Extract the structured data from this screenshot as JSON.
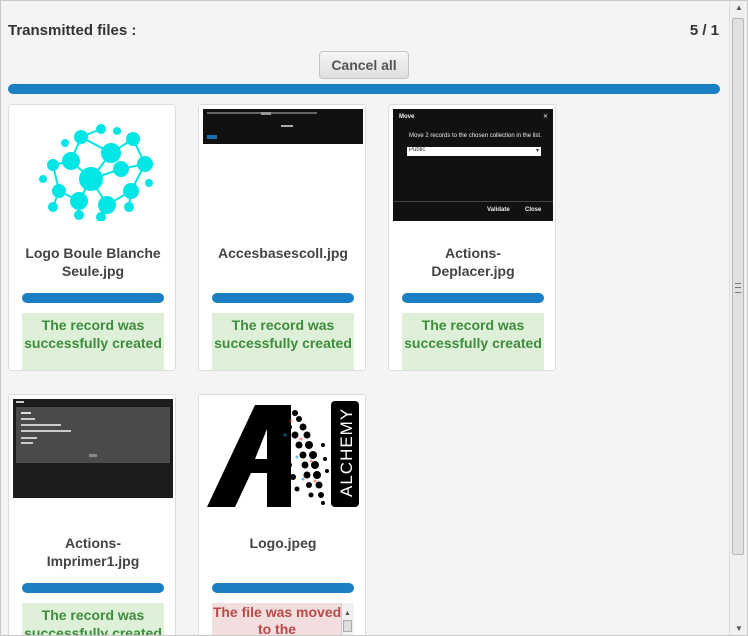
{
  "header": {
    "title": "Transmitted files :",
    "counter": "5 / 1"
  },
  "toolbar": {
    "cancel_all_label": "Cancel all"
  },
  "files": [
    {
      "name": "Logo Boule Blanche Seule.jpg",
      "status": "The record was successfully created",
      "status_type": "success",
      "progress": 1.0
    },
    {
      "name": "Accesbasescoll.jpg",
      "status": "The record was successfully created",
      "status_type": "success",
      "progress": 1.0
    },
    {
      "name": "Actions-Deplacer.jpg",
      "status": "The record was successfully created",
      "status_type": "success",
      "progress": 1.0
    },
    {
      "name": "Actions-Imprimer1.jpg",
      "status": "The record was successfully created",
      "status_type": "success",
      "progress": 1.0
    },
    {
      "name": "Logo.jpeg",
      "status": "The file was moved to the",
      "status_type": "error",
      "progress": 1.0
    }
  ],
  "thumbnails": {
    "deplacer": {
      "dialog_title": "Move",
      "message": "Move 2 records to the chosen collection in the list.",
      "select_value": "Public",
      "validate_label": "Validate",
      "close_label": "Close"
    },
    "logo_text": "ALCHEMY"
  },
  "colors": {
    "accent": "#1b80c3",
    "success_bg": "#dff0d8",
    "success_text": "#3c8d3c",
    "error_bg": "#f2dede",
    "error_text": "#b94a48",
    "cyan": "#00e5e5"
  }
}
